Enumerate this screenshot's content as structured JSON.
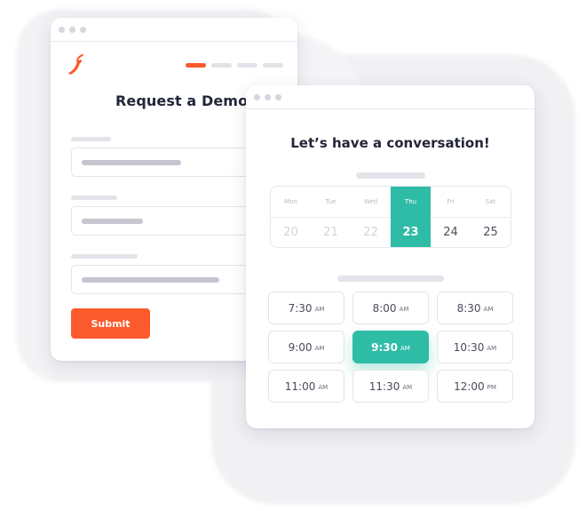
{
  "request_form": {
    "title": "Request a Demo",
    "submit_label": "Submit",
    "progress_steps": 4,
    "active_step": 1
  },
  "scheduler": {
    "title": "Let’s have a conversation!",
    "days": [
      {
        "name": "Mon",
        "date": "20",
        "state": "past"
      },
      {
        "name": "Tue",
        "date": "21",
        "state": "past"
      },
      {
        "name": "Wed",
        "date": "22",
        "state": "past"
      },
      {
        "name": "Thu",
        "date": "23",
        "state": "selected"
      },
      {
        "name": "Fri",
        "date": "24",
        "state": "available"
      },
      {
        "name": "Sat",
        "date": "25",
        "state": "available"
      }
    ],
    "slots": [
      {
        "time": "7:30",
        "ampm": "AM"
      },
      {
        "time": "8:00",
        "ampm": "AM"
      },
      {
        "time": "8:30",
        "ampm": "AM"
      },
      {
        "time": "9:00",
        "ampm": "AM"
      },
      {
        "time": "9:30",
        "ampm": "AM",
        "selected": true
      },
      {
        "time": "10:30",
        "ampm": "AM"
      },
      {
        "time": "11:00",
        "ampm": "AM"
      },
      {
        "time": "11:30",
        "ampm": "AM"
      },
      {
        "time": "12:00",
        "ampm": "PM"
      }
    ]
  },
  "colors": {
    "brand_orange": "#fb5a2c",
    "accent_teal": "#2ebca6",
    "text_dark": "#232638"
  },
  "icons": {
    "logo": "chili-pepper-logo"
  }
}
